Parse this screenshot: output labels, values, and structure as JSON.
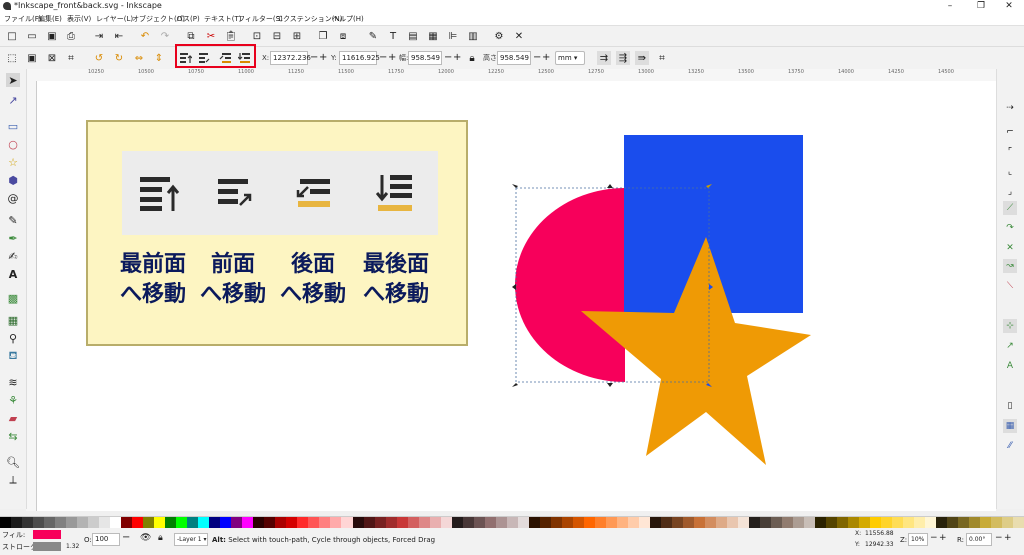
{
  "window": {
    "title": "*Inkscape_front&back.svg - Inkscape"
  },
  "menu": [
    "ファイル(F)",
    "編集(E)",
    "表示(V)",
    "レイヤー(L)",
    "オブジェクト(O)",
    "パス(P)",
    "テキスト(T)",
    "フィルター(S)",
    "エクステンション(N)",
    "ヘルプ(H)"
  ],
  "toolbar": {
    "x_label": "X:",
    "x_value": "12372.236",
    "y_label": "Y:",
    "y_value": "11616.925",
    "w_label": "幅:",
    "w_value": "958.549",
    "h_label": "高さ:",
    "h_value": "958.549",
    "unit": "mm"
  },
  "ruler_ticks": [
    "10250",
    "10500",
    "10750",
    "11000",
    "11250",
    "11500",
    "11750",
    "12000",
    "12250",
    "12500",
    "12750",
    "13000",
    "13250",
    "13500",
    "13750",
    "14000",
    "14250",
    "14500"
  ],
  "card": {
    "labels": [
      {
        "line1": "最前面",
        "line2": "へ移動"
      },
      {
        "line1": "前面",
        "line2": "へ移動"
      },
      {
        "line1": "後面",
        "line2": "へ移動"
      },
      {
        "line1": "最後面",
        "line2": "へ移動"
      }
    ]
  },
  "colors": {
    "accent": "#e8001c",
    "card_bg": "#fdf5c2",
    "card_border": "#b8ad6a",
    "label_color": "#0b1a5c",
    "pink": "#f7005b",
    "blue": "#1a4ded",
    "orange": "#ef9a05"
  },
  "status": {
    "fill_label": "フィル:",
    "stroke_label": "ストローク:",
    "stroke_width": "1.32",
    "opacity_label": "O:",
    "opacity_value": "100",
    "layer": "-Layer 1",
    "message_bold": "Alt:",
    "message": " Select with touch-path, Cycle through objects, Forced Drag",
    "cursor_x_label": "X:",
    "cursor_x": "11556.88",
    "cursor_y_label": "Y:",
    "cursor_y": "12942.33",
    "zoom_label": "Z:",
    "zoom": "10%",
    "rotate_label": "R:",
    "rotate": "0.00°"
  }
}
